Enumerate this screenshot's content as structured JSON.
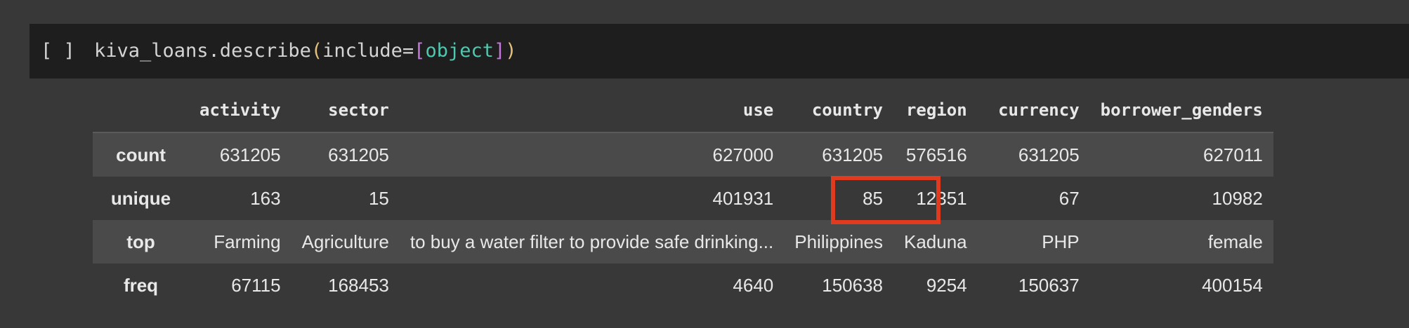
{
  "cell": {
    "run_indicator": "[ ]",
    "code": {
      "object": "kiva_loans.describe",
      "open_paren": "(",
      "kwarg": "include=",
      "open_bracket": "[",
      "arg": "object",
      "close_bracket": "]",
      "close_paren": ")"
    }
  },
  "table": {
    "columns": [
      "",
      "activity",
      "sector",
      "use",
      "country",
      "region",
      "currency",
      "borrower_genders"
    ],
    "rows": [
      {
        "label": "count",
        "values": [
          "631205",
          "631205",
          "627000",
          "631205",
          "576516",
          "631205",
          "627011"
        ]
      },
      {
        "label": "unique",
        "values": [
          "163",
          "15",
          "401931",
          "85",
          "12351",
          "67",
          "10982"
        ]
      },
      {
        "label": "top",
        "values": [
          "Farming",
          "Agriculture",
          "to buy a water filter to provide safe drinking...",
          "Philippines",
          "Kaduna",
          "PHP",
          "female"
        ]
      },
      {
        "label": "freq",
        "values": [
          "67115",
          "168453",
          "4640",
          "150638",
          "9254",
          "150637",
          "400154"
        ]
      }
    ]
  },
  "colors": {
    "background": "#383838",
    "cell_background": "#1e1e1e",
    "highlight": "#e03a1f"
  }
}
